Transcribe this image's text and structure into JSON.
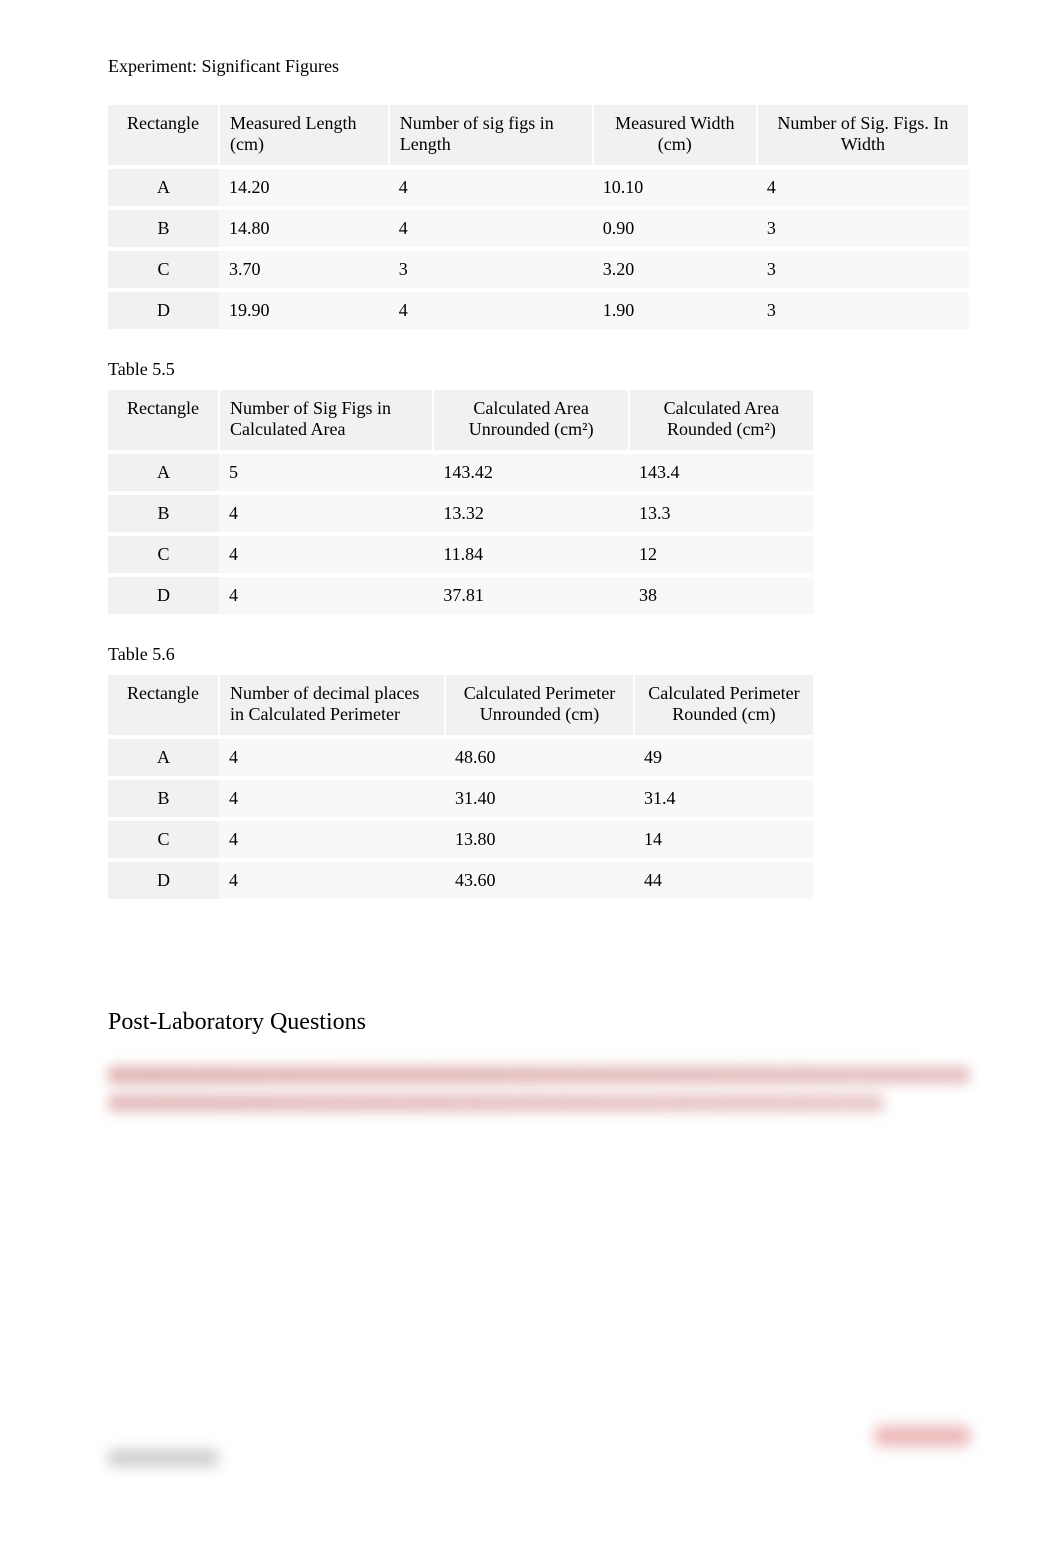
{
  "title": "Experiment: Significant Figures",
  "table54": {
    "headers": [
      "Rectangle",
      "Measured Length (cm)",
      "Number of sig figs in Length",
      "Measured Width (cm)",
      "Number of Sig. Figs. In Width"
    ],
    "rows": [
      {
        "r": "A",
        "len": "14.20",
        "sfLen": "4",
        "wid": "10.10",
        "sfWid": "4"
      },
      {
        "r": "B",
        "len": "14.80",
        "sfLen": "4",
        "wid": "0.90",
        "sfWid": "3"
      },
      {
        "r": "C",
        "len": "3.70",
        "sfLen": "3",
        "wid": "3.20",
        "sfWid": "3"
      },
      {
        "r": "D",
        "len": "19.90",
        "sfLen": "4",
        "wid": "1.90",
        "sfWid": "3"
      }
    ]
  },
  "caption55": "Table 5.5",
  "table55": {
    "headers": [
      "Rectangle",
      "Number of Sig Figs in Calculated Area",
      "Calculated Area Unrounded (cm²)",
      "Calculated Area Rounded (cm²)"
    ],
    "rows": [
      {
        "r": "A",
        "sf": "5",
        "un": "143.42",
        "rd": "143.4"
      },
      {
        "r": "B",
        "sf": "4",
        "un": "13.32",
        "rd": "13.3"
      },
      {
        "r": "C",
        "sf": "4",
        "un": "11.84",
        "rd": "12"
      },
      {
        "r": "D",
        "sf": "4",
        "un": "37.81",
        "rd": "38"
      }
    ]
  },
  "caption56": "Table 5.6",
  "table56": {
    "headers": [
      "Rectangle",
      "Number of decimal places in Calculated Perimeter",
      "Calculated Perimeter Unrounded (cm)",
      "Calculated Perimeter Rounded (cm)"
    ],
    "rows": [
      {
        "r": "A",
        "dp": "4",
        "un": "48.60",
        "rd": "49"
      },
      {
        "r": "B",
        "dp": "4",
        "un": "31.40",
        "rd": "31.4"
      },
      {
        "r": "C",
        "dp": "4",
        "un": "13.80",
        "rd": "14"
      },
      {
        "r": "D",
        "dp": "4",
        "un": "43.60",
        "rd": "44"
      }
    ]
  },
  "postLabTitle": "Post-Laboratory Questions"
}
